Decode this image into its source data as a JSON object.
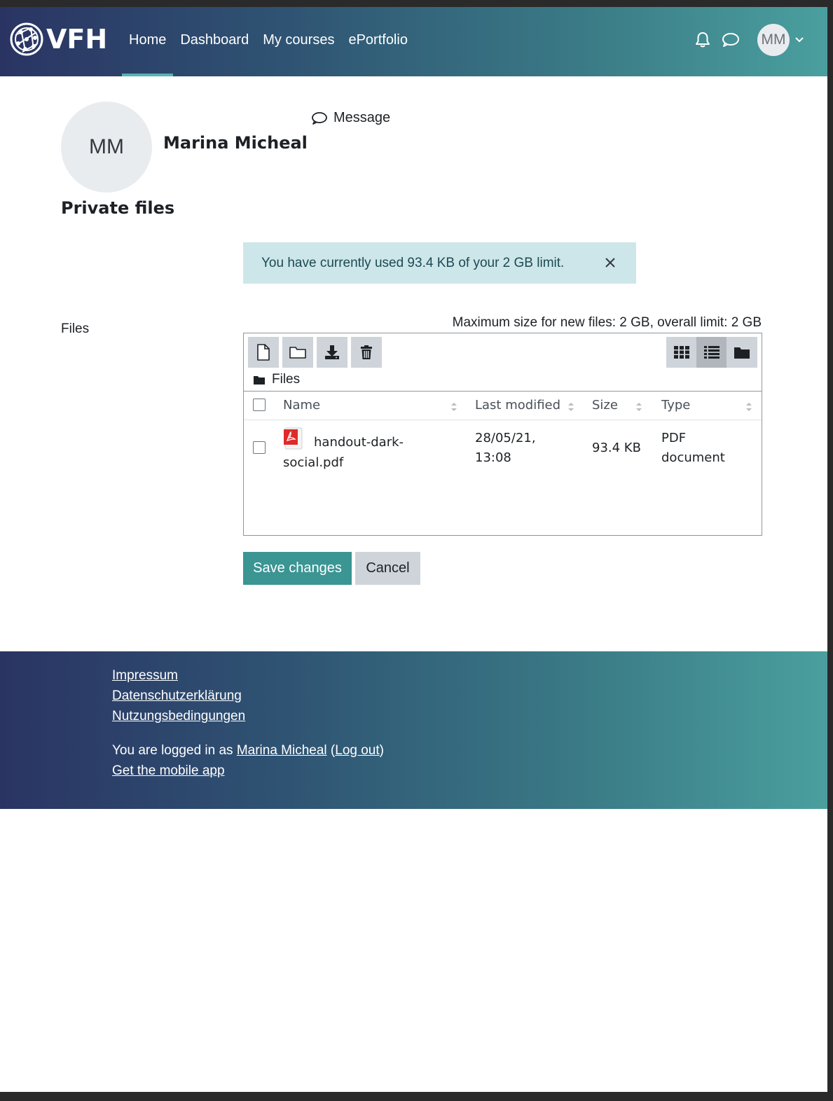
{
  "navbar": {
    "brand": "VFH",
    "links": [
      {
        "label": "Home",
        "active": true
      },
      {
        "label": "Dashboard",
        "active": false
      },
      {
        "label": "My courses",
        "active": false
      },
      {
        "label": "ePortfolio",
        "active": false
      }
    ],
    "user_initials": "MM",
    "icons": [
      "bell-icon",
      "chat-icon",
      "chevron-down-icon"
    ]
  },
  "profile": {
    "initials": "MM",
    "name": "Marina Micheal",
    "message_label": "Message"
  },
  "page": {
    "heading": "Private files",
    "alert_text": "You have currently used 93.4 KB of your 2 GB limit.",
    "files_label": "Files",
    "max_size_text": "Maximum size for new files: 2 GB, overall limit: 2 GB"
  },
  "filemanager": {
    "toolbar": [
      "add-file-icon",
      "create-folder-icon",
      "download-icon",
      "delete-icon"
    ],
    "views": [
      "grid-view-icon",
      "list-view-icon",
      "tree-view-icon"
    ],
    "active_view": "list",
    "path": "Files",
    "columns": {
      "name": "Name",
      "modified": "Last modified",
      "size": "Size",
      "type": "Type"
    },
    "files": [
      {
        "name_line1": "handout-dark-",
        "name_line2": "social.pdf",
        "modified_line1": "28/05/21,",
        "modified_line2": "13:08",
        "size": "93.4 KB",
        "type_line1": "PDF",
        "type_line2": "document"
      }
    ]
  },
  "buttons": {
    "save": "Save changes",
    "cancel": "Cancel"
  },
  "footer": {
    "links": [
      "Impressum",
      "Datenschutzerklärung",
      "Nutzungsbedingungen"
    ],
    "logged_in_prefix": "You are logged in as ",
    "user_name": "Marina Micheal",
    "logout_label": "Log out",
    "mobile_app": "Get the mobile app"
  },
  "colors": {
    "primary": "#3a9593",
    "alert_bg": "#cde6ea",
    "navbar_start": "#2a3463",
    "navbar_end": "#4a9f9e"
  }
}
